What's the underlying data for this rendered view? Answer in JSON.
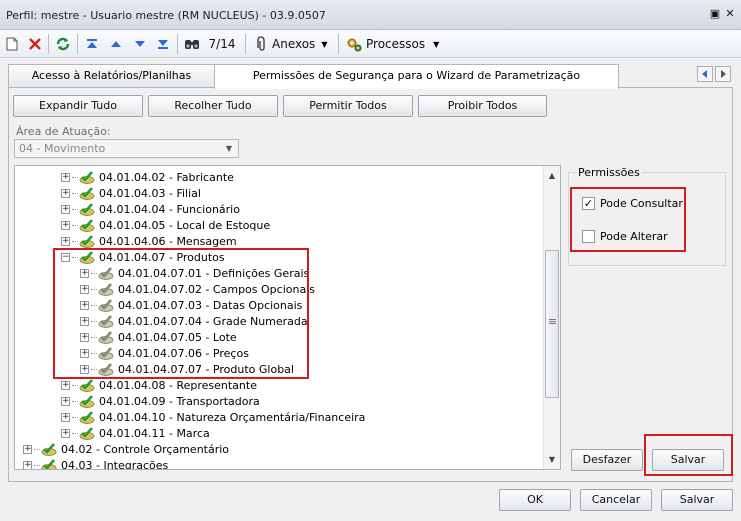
{
  "window": {
    "title": "Perfil: mestre - Usuario mestre (RM NUCLEUS) - 03.9.0507"
  },
  "toolbar": {
    "record_position": "7/14",
    "attachments_label": "Anexos",
    "processes_label": "Processos"
  },
  "tabs": [
    {
      "label": "Acesso à Relatórios/Planilhas"
    },
    {
      "label": "Permissões de Segurança para o Wizard de Parametrização"
    }
  ],
  "actions": {
    "expand_all": "Expandir Tudo",
    "collapse_all": "Recolher Tudo",
    "allow_all": "Permitir Todos",
    "deny_all": "Proibir Todos"
  },
  "area": {
    "label": "Área de Atuação:",
    "value": "04 - Movimento"
  },
  "tree": [
    {
      "label": "04.01.04.02 - Fabricante"
    },
    {
      "label": "04.01.04.03 - Filial"
    },
    {
      "label": "04.01.04.04 - Funcionário"
    },
    {
      "label": "04.01.04.05 - Local de Estoque"
    },
    {
      "label": "04.01.04.06 - Mensagem"
    },
    {
      "label": "04.01.04.07 - Produtos"
    },
    {
      "label": "04.01.04.07.01 - Definições Gerais"
    },
    {
      "label": "04.01.04.07.02 - Campos Opcionais"
    },
    {
      "label": "04.01.04.07.03 - Datas Opcionais"
    },
    {
      "label": "04.01.04.07.04 - Grade Numerada"
    },
    {
      "label": "04.01.04.07.05 - Lote"
    },
    {
      "label": "04.01.04.07.06 - Preços"
    },
    {
      "label": "04.01.04.07.07 - Produto Global"
    },
    {
      "label": "04.01.04.08 - Representante"
    },
    {
      "label": "04.01.04.09 - Transportadora"
    },
    {
      "label": "04.01.04.10 - Natureza Orçamentária/Financeira"
    },
    {
      "label": "04.01.04.11 - Marca"
    },
    {
      "label": "04.02 - Controle Orçamentário"
    },
    {
      "label": "04.03 - Integrações"
    }
  ],
  "permissions": {
    "title": "Permissões",
    "can_view": {
      "label": "Pode Consultar",
      "checked": true
    },
    "can_edit": {
      "label": "Pode Alterar",
      "checked": false
    },
    "undo_label": "Desfazer",
    "save_label": "Salvar"
  },
  "footer": {
    "ok": "OK",
    "cancel": "Cancelar",
    "save": "Salvar"
  },
  "colors": {
    "highlight": "#d41b1b",
    "accent": "#2f6bd8"
  }
}
